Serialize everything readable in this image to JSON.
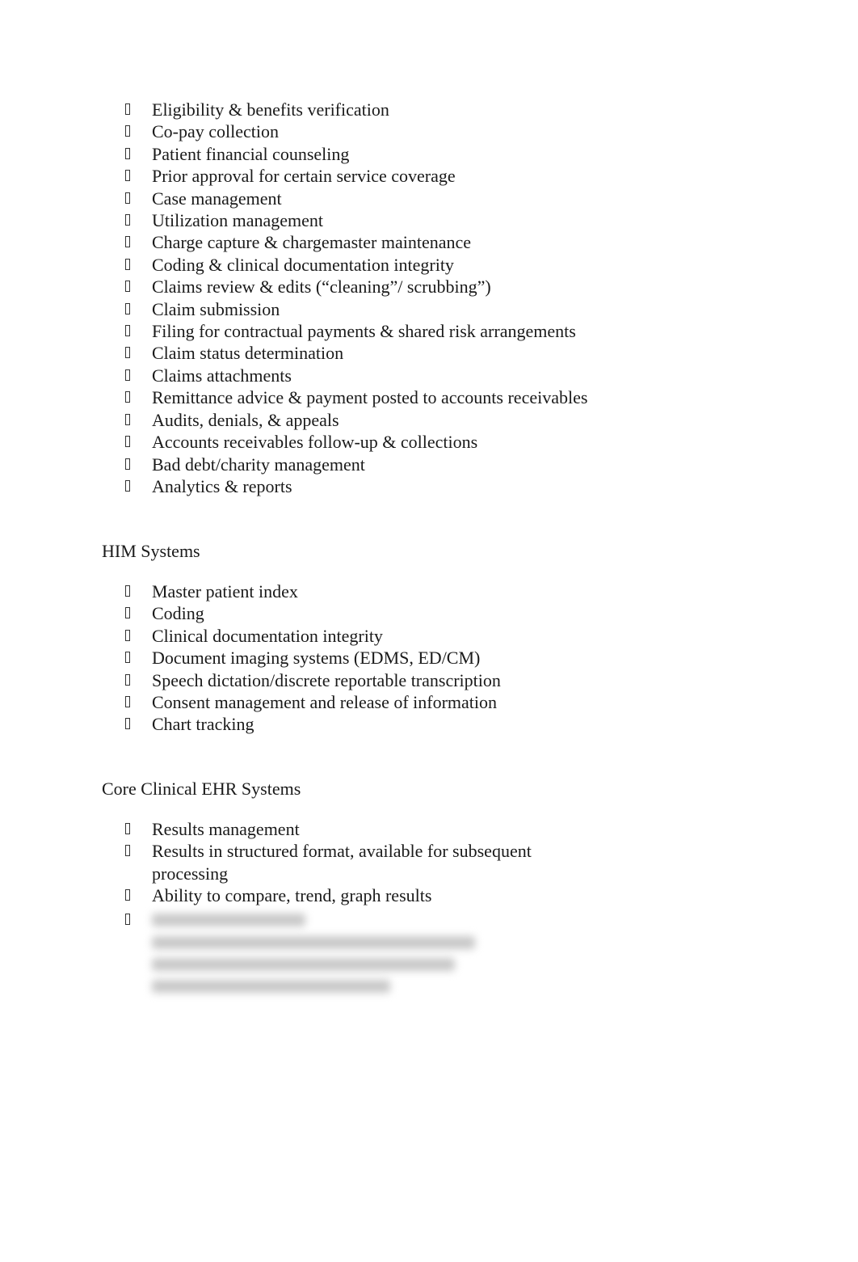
{
  "bullet_icon": "missing-glyph-box",
  "sections": {
    "rcm": {
      "items": [
        "Eligibility & benefits verification",
        "Co-pay collection",
        "Patient financial counseling",
        "Prior approval for certain service coverage",
        "Case management",
        "Utilization management",
        "Charge capture & chargemaster maintenance",
        "Coding & clinical documentation integrity",
        "Claims review & edits (“cleaning”/ scrubbing”)",
        "Claim submission",
        "Filing for contractual payments & shared risk arrangements",
        "Claim status determination",
        "Claims attachments",
        "Remittance advice & payment posted to accounts receivables",
        "Audits, denials, & appeals",
        "Accounts receivables follow-up & collections",
        "Bad debt/charity management",
        "Analytics & reports"
      ]
    },
    "him": {
      "heading": "HIM Systems",
      "items": [
        "Master patient index",
        "Coding",
        "Clinical documentation integrity",
        "Document imaging systems (EDMS, ED/CM)",
        "Speech dictation/discrete reportable transcription",
        "Consent management and release of information",
        "Chart tracking"
      ]
    },
    "ehr": {
      "heading": "Core Clinical EHR Systems",
      "items": [
        "Results management",
        "Results in structured format, available for subsequent processing",
        "Ability to compare, trend, graph results"
      ],
      "obscured_content": "blurred"
    }
  }
}
